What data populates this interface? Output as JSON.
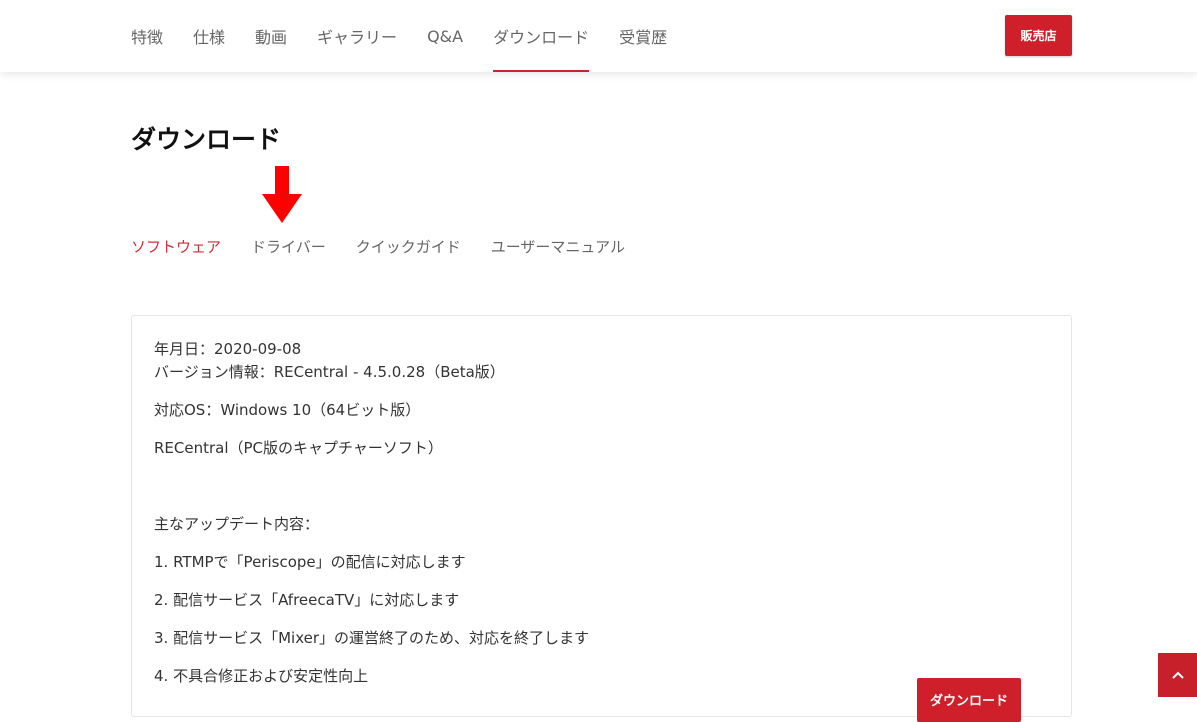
{
  "nav": {
    "items": [
      {
        "label": "特徴"
      },
      {
        "label": "仕様"
      },
      {
        "label": "動画"
      },
      {
        "label": "ギャラリー"
      },
      {
        "label": "Q&A"
      },
      {
        "label": "ダウンロード",
        "active": true
      },
      {
        "label": "受賞歴"
      }
    ],
    "dealer_label": "販売店"
  },
  "page": {
    "title": "ダウンロード"
  },
  "annotation": {
    "icon": "red-arrow-down-icon",
    "color": "#ff0000"
  },
  "subtabs": [
    {
      "label": "ソフトウェア",
      "active": true
    },
    {
      "label": "ドライバー"
    },
    {
      "label": "クイックガイド"
    },
    {
      "label": "ユーザーマニュアル"
    }
  ],
  "release": {
    "date": "年月日：2020-09-08",
    "version": "バージョン情報：RECentral - 4.5.0.28（Beta版）",
    "os": "対応OS：Windows 10（64ビット版）",
    "description": "RECentral（PC版のキャプチャーソフト）",
    "updates_heading": "主なアップデート内容：",
    "updates": [
      "1. RTMPで「Periscope」の配信に対応します",
      "2. 配信サービス「AfreecaTV」に対応します",
      "3. 配信サービス「Mixer」の運営終了のため、対応を終了します",
      "4. 不具合修正および安定性向上"
    ],
    "download_label": "ダウンロード"
  },
  "scroll_top": {
    "icon": "chevron-up-icon"
  },
  "colors": {
    "accent": "#cf1f2a",
    "active_tab_text": "#c8303a",
    "text": "#333333",
    "nav_text": "#666666"
  }
}
